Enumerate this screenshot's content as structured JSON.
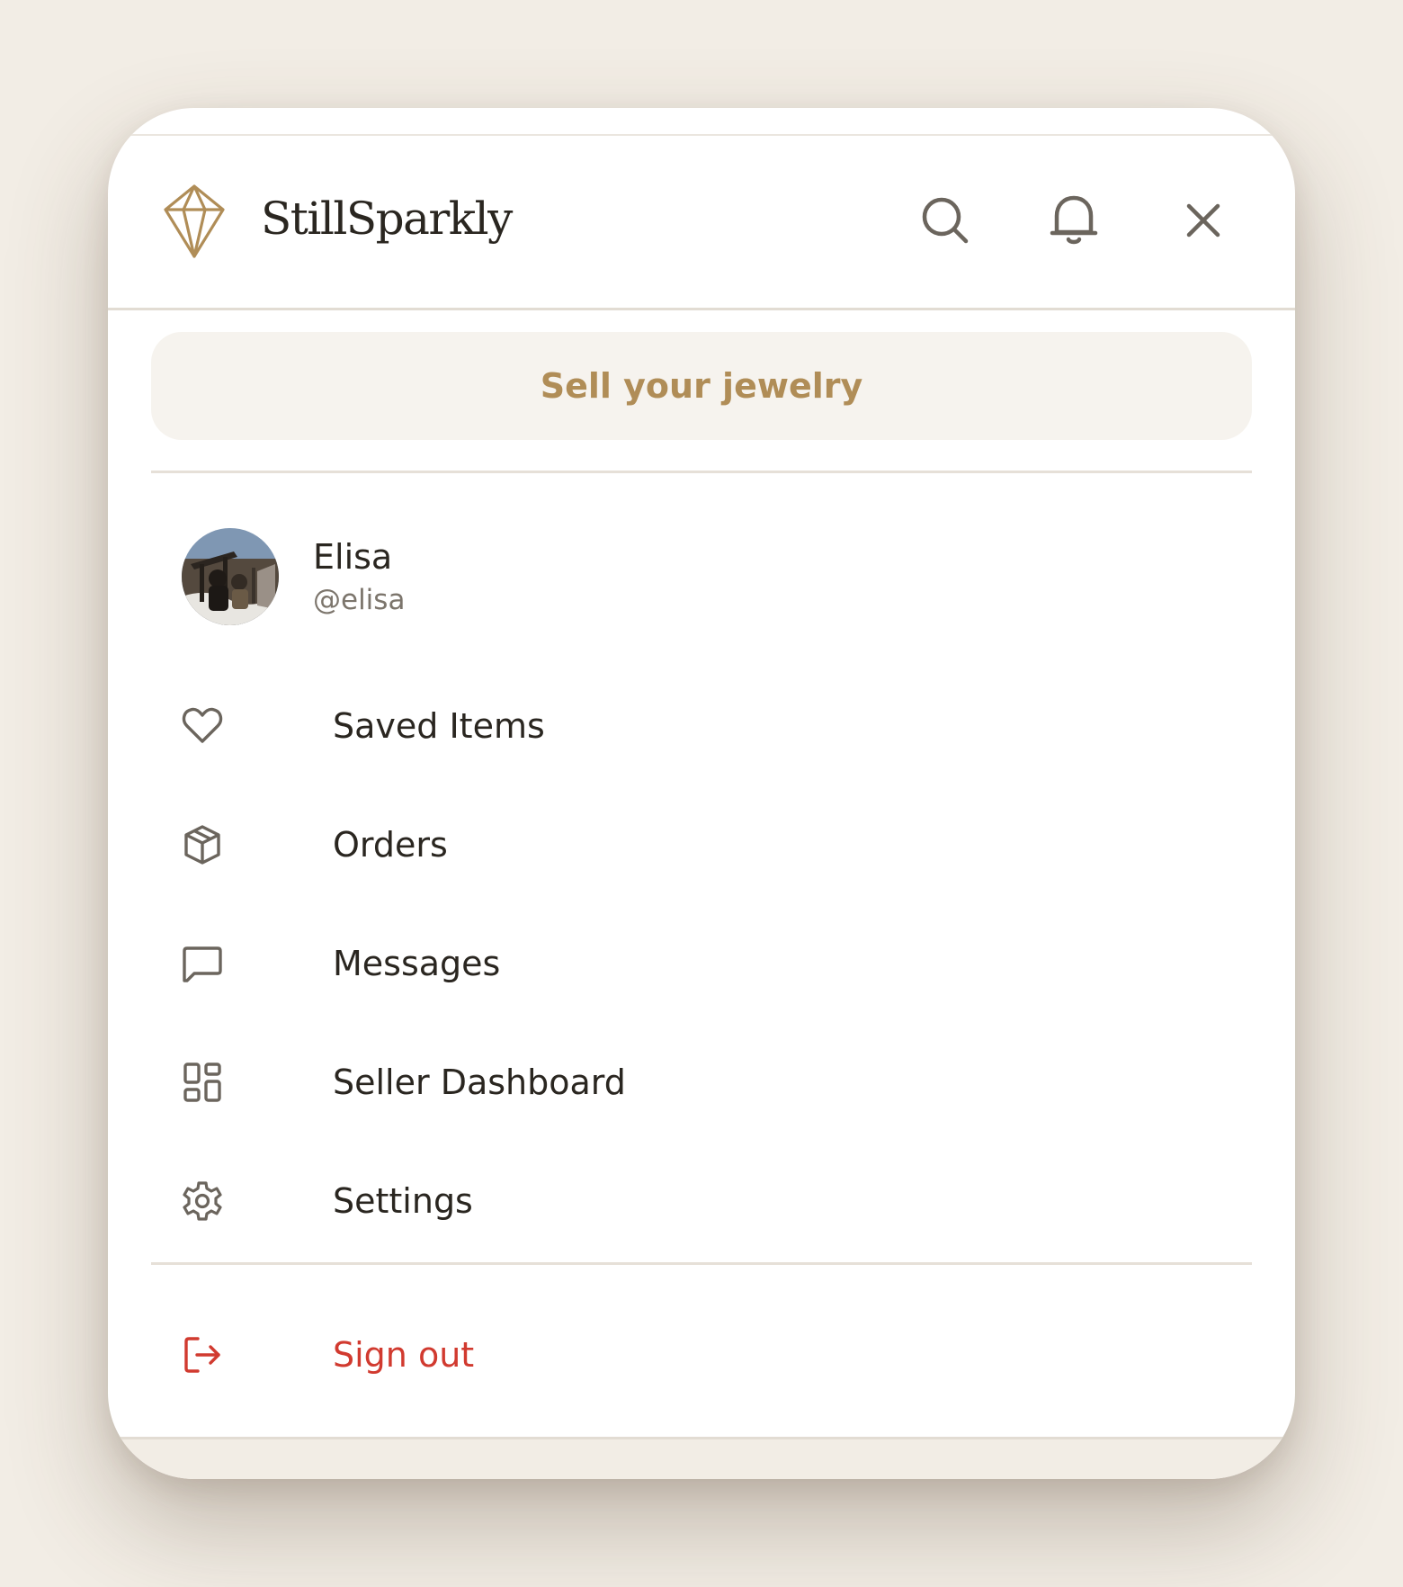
{
  "app": {
    "brand_name": "StillSparkly",
    "accent_color": "#b08d57",
    "danger_color": "#d13a2f"
  },
  "header": {
    "icons": [
      "diamond-logo-icon",
      "search-icon",
      "bell-icon",
      "close-icon"
    ]
  },
  "sell": {
    "label": "Sell your jewelry"
  },
  "profile": {
    "name": "Elisa",
    "handle": "@elisa"
  },
  "menu": {
    "items": [
      {
        "label": "Saved Items",
        "icon": "heart-icon"
      },
      {
        "label": "Orders",
        "icon": "package-icon"
      },
      {
        "label": "Messages",
        "icon": "message-icon"
      },
      {
        "label": "Seller Dashboard",
        "icon": "dashboard-icon"
      },
      {
        "label": "Settings",
        "icon": "gear-icon"
      }
    ]
  },
  "signout": {
    "label": "Sign out",
    "icon": "logout-icon"
  }
}
